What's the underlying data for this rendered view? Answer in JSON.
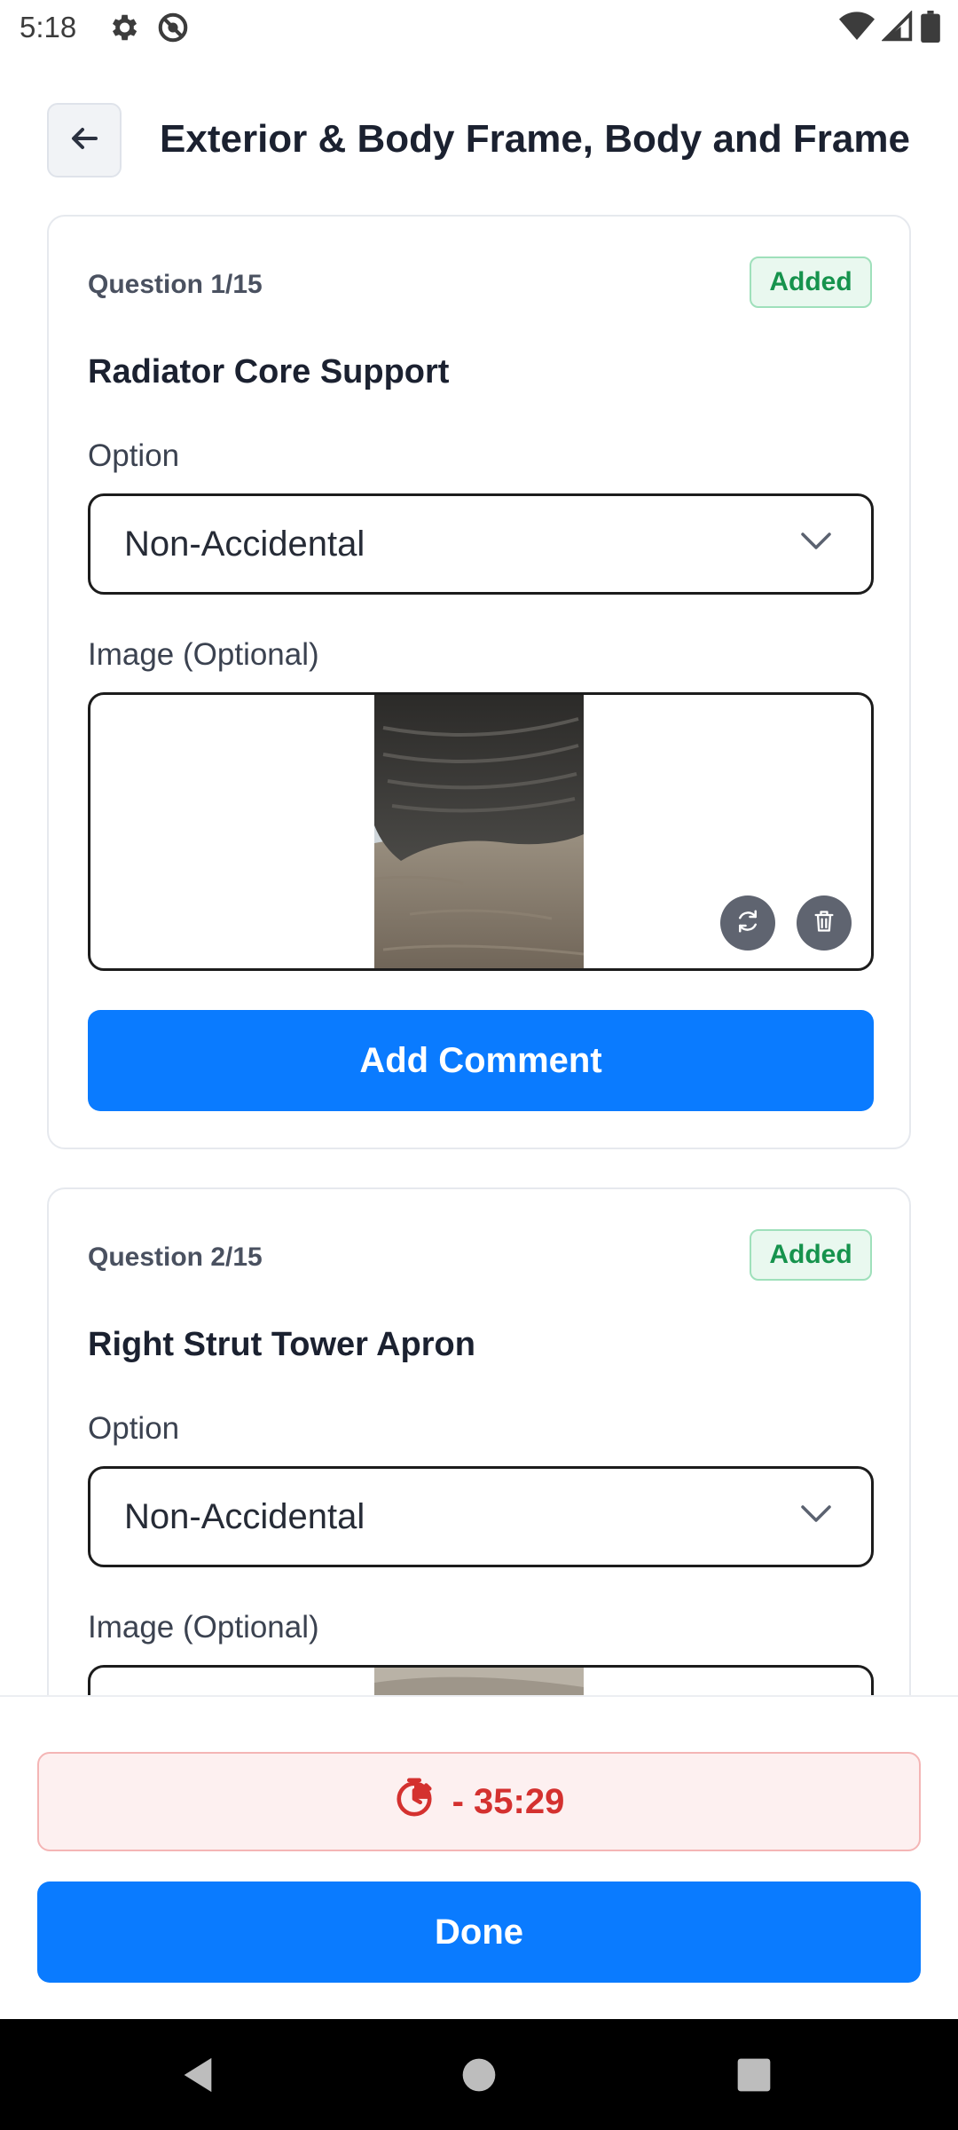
{
  "status_bar": {
    "time": "5:18",
    "icons_left": [
      "gear-icon",
      "no-sync-icon"
    ],
    "icons_right": [
      "wifi-icon",
      "signal-icon",
      "battery-icon"
    ]
  },
  "header": {
    "title": "Exterior & Body Frame, Body and Frame",
    "back_icon": "arrow-left-icon"
  },
  "questions": [
    {
      "counter": "Question 1/15",
      "badge": "Added",
      "title": "Radiator Core Support",
      "option_label": "Option",
      "option_value": "Non-Accidental",
      "image_label": "Image (Optional)",
      "comment_button": "Add Comment"
    },
    {
      "counter": "Question 2/15",
      "badge": "Added",
      "title": "Right Strut Tower Apron",
      "option_label": "Option",
      "option_value": "Non-Accidental",
      "image_label": "Image (Optional)"
    }
  ],
  "footer": {
    "timer": "- 35:29",
    "timer_icon": "timer-icon",
    "done_button": "Done"
  },
  "colors": {
    "primary": "#0a7bff",
    "badge_green": "#16934d",
    "timer_red": "#d4312f"
  }
}
